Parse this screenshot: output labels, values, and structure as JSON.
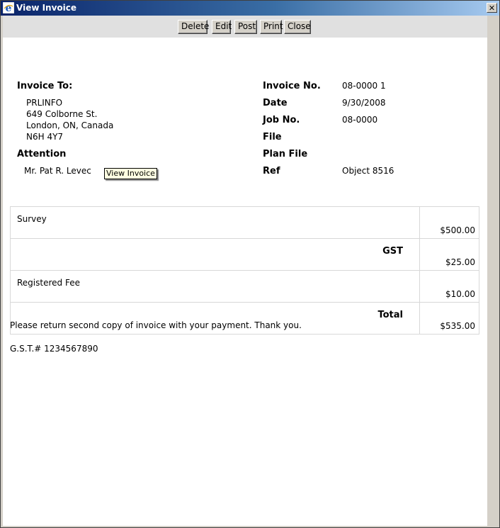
{
  "window": {
    "title": "View Invoice"
  },
  "toolbar": {
    "buttons": [
      "Delete",
      "Edit",
      "Post",
      "Print",
      "Close"
    ]
  },
  "bill_to": {
    "heading": "Invoice To:",
    "address_lines": [
      "PRLINFO",
      "649 Colborne St.",
      "London, ON, Canada",
      "N6H 4Y7"
    ],
    "attention_heading": "Attention",
    "attention_value": "Mr. Pat R. Levec"
  },
  "details": [
    {
      "label": "Invoice No.",
      "value": "08-0000 1"
    },
    {
      "label": "Date",
      "value": "9/30/2008"
    },
    {
      "label": "Job No.",
      "value": "08-0000"
    },
    {
      "label": "File",
      "value": ""
    },
    {
      "label": "Plan File",
      "value": ""
    },
    {
      "label": "Ref",
      "value": "Object 8516"
    }
  ],
  "tooltip": "View Invoice",
  "line_items": [
    {
      "description": "Survey",
      "align": "left",
      "amount": "$500.00"
    },
    {
      "description": "GST",
      "align": "right",
      "amount": "$25.00"
    },
    {
      "description": "Registered Fee",
      "align": "left",
      "amount": "$10.00"
    },
    {
      "description": "Total",
      "align": "right",
      "amount": "$535.00"
    }
  ],
  "footer": {
    "note": "Please return second copy of invoice with your payment. Thank you.",
    "gst_number": "G.S.T.# 1234567890"
  }
}
